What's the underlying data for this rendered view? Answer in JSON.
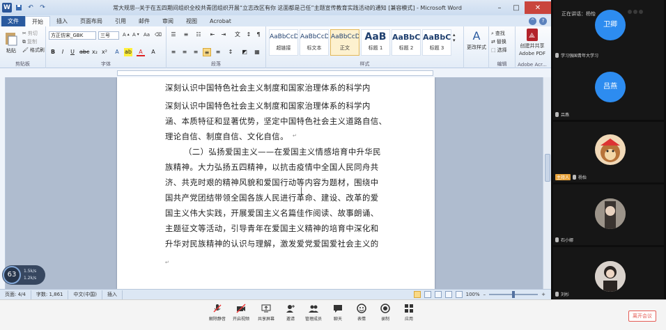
{
  "word": {
    "title": "常大规思--关于在五四期间组织全校共青团组织开展“立志改区有你 这面都是己任”主题宣传教育实践活动的通知 [兼容模式] - Microsoft Word",
    "qat_icons": [
      "save-icon",
      "undo-icon",
      "redo-icon"
    ],
    "tabs": [
      "文件",
      "开始",
      "插入",
      "页面布局",
      "引用",
      "邮件",
      "审阅",
      "视图",
      "Acrobat"
    ],
    "ribbon": {
      "clipboard": {
        "label": "剪贴板",
        "paste": "粘贴",
        "cut": "剪切",
        "copy": "复制",
        "format_painter": "格式刷"
      },
      "font": {
        "label": "字体",
        "font_name": "方正仿宋_GBK",
        "font_size": "三号"
      },
      "paragraph": {
        "label": "段落"
      },
      "styles": {
        "label": "样式",
        "items": [
          {
            "sample": "AaBbCcD",
            "name": "超链接"
          },
          {
            "sample": "AaBbCcDd",
            "name": "标文本"
          },
          {
            "sample": "AaBbCcD",
            "name": "正文"
          },
          {
            "sample": "AaB",
            "name": "标题 1"
          },
          {
            "sample": "AaBbC",
            "name": "标题 2"
          },
          {
            "sample": "AaBbC",
            "name": "标题 3"
          }
        ],
        "change_styles": "更改样式"
      },
      "editing": {
        "label": "编辑",
        "find": "查找",
        "replace": "替换",
        "select": "选择"
      },
      "adobe": {
        "label": "Adobe Acr...",
        "create_share": "创建并共享",
        "pdf": "Adobe PDF"
      }
    },
    "document": {
      "lines": [
        "深刻认识中国特色社会主义制度和国家治理体系的科学内",
        "深刻认识中国特色社会主义制度和国家治理体系的科学内",
        "涵、本质特征和显著优势，坚定中国特色社会主义道路自信、",
        "理论自信、制度自信、文化自信。",
        "（二）弘扬爱国主义——在爱国主义情感培育中升华民",
        "族精神。大力弘扬五四精神，以抗击疫情中全国人民同舟共",
        "济、共克时艰的精神风貌和爱国行动等内容为题材，围绕中",
        "国共产党团结带领全国各族人民进行革命、建设、改革的爱",
        "国主义伟大实践，开展爱国主义名篇佳作阅读、故事朗诵、",
        "主题征文等活动，引导青年在爱国主义精神的培育中深化和",
        "升华对民族精神的认识与理解，激发爱党爱国爱社会主义的"
      ]
    },
    "status": {
      "page": "页面: 4/4",
      "words": "字数: 1,861",
      "language": "中文(中国)",
      "mode": "插入",
      "zoom": "100%",
      "zoom_fraction": 0.5
    }
  },
  "timer": {
    "value": "63",
    "line1": "1.5k/s",
    "line2": "1.2k/s"
  },
  "meeting_toolbar": {
    "buttons": [
      {
        "label": "解除静音",
        "icon": "mic-muted-icon"
      },
      {
        "label": "开启视频",
        "icon": "camera-off-icon"
      },
      {
        "label": "共享屏幕",
        "icon": "share-screen-icon"
      },
      {
        "label": "邀请",
        "icon": "invite-icon"
      },
      {
        "label": "管理成员",
        "icon": "members-icon"
      },
      {
        "label": "聊天",
        "icon": "chat-icon"
      },
      {
        "label": "表情",
        "icon": "emoji-icon"
      },
      {
        "label": "录制",
        "icon": "record-icon"
      },
      {
        "label": "应用",
        "icon": "apps-icon"
      }
    ],
    "leave": "离开会议"
  },
  "participants": {
    "top_text": "正在讲话：杨怡",
    "tiles": [
      {
        "avatar_text": "卫卿",
        "name": "学习强国青年大学习"
      },
      {
        "avatar_text": "吕燕",
        "name": "吕燕"
      },
      {
        "avatar_text": "",
        "name": "杨怡",
        "host": "主持人"
      },
      {
        "avatar_text": "",
        "name": "石小娜"
      },
      {
        "avatar_text": "",
        "name": "刘杉"
      }
    ]
  },
  "colors": {
    "word_blue": "#2a5a9f",
    "avatar_blue": "#2d8cf0",
    "leave_red": "#e45b54",
    "host_orange": "#e8a33c"
  }
}
